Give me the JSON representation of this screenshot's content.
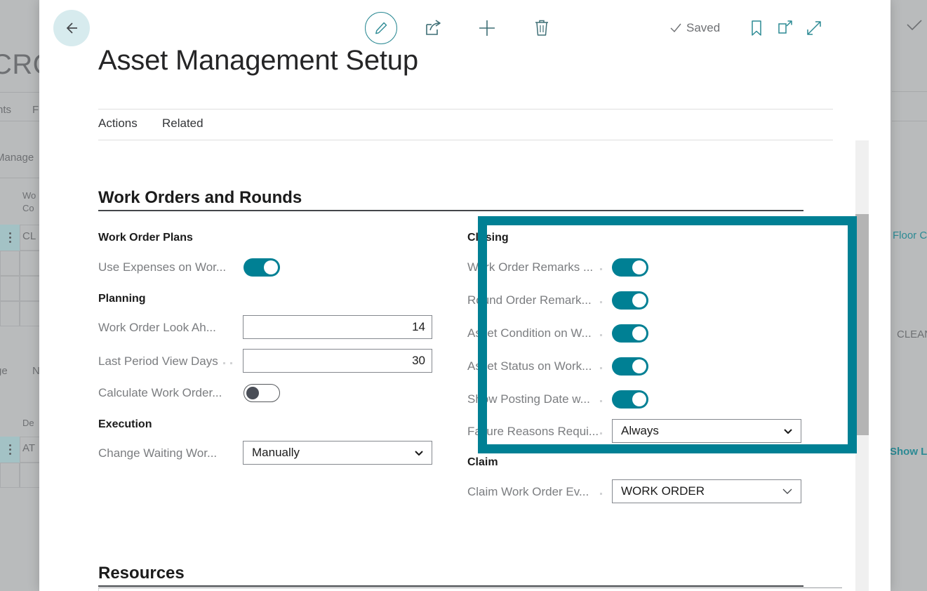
{
  "background": {
    "title": "CRO",
    "tab_a": "nts",
    "tab_b": "F",
    "menu": "Manage",
    "col_header_line1": "Wo",
    "col_header_line2": "Co",
    "row1_value": "CL",
    "lower_menu_a": "ge",
    "lower_menu_b": "N",
    "lower_col_header": "De",
    "row2_value": "AT",
    "right_link_top": "Floor C",
    "right_text": "CLEAN",
    "right_link_bottom": "Show L",
    "accent": "#2c8a94"
  },
  "toolbar": {
    "back_label": "Back",
    "edit_label": "Edit",
    "share_label": "Share",
    "new_label": "New",
    "delete_label": "Delete",
    "saved_label": "Saved",
    "bookmark_label": "Bookmark",
    "popout_label": "Open in new window",
    "expand_label": "Expand"
  },
  "page": {
    "title": "Asset Management Setup"
  },
  "tabs": [
    {
      "label": "Actions"
    },
    {
      "label": "Related"
    }
  ],
  "sections": {
    "work_orders": {
      "heading": "Work Orders and Rounds",
      "left": {
        "groups": [
          {
            "name": "Work Order Plans",
            "fields": [
              {
                "label": "Use Expenses on Wor...",
                "type": "toggle",
                "value": "on"
              }
            ]
          },
          {
            "name": "Planning",
            "fields": [
              {
                "label": "Work Order Look Ah...",
                "type": "number",
                "value": "14"
              },
              {
                "label": "Last Period View Days",
                "type": "number",
                "value": "30"
              },
              {
                "label": "Calculate Work Order...",
                "type": "toggle",
                "value": "off"
              }
            ]
          },
          {
            "name": "Execution",
            "fields": [
              {
                "label": "Change Waiting Wor...",
                "type": "select",
                "value": "Manually"
              }
            ]
          }
        ]
      },
      "right": {
        "groups": [
          {
            "name": "Closing",
            "highlighted": true,
            "fields": [
              {
                "label": "Work Order Remarks ...",
                "type": "toggle",
                "value": "on"
              },
              {
                "label": "Round Order Remark...",
                "type": "toggle",
                "value": "on"
              },
              {
                "label": "Asset Condition on W...",
                "type": "toggle",
                "value": "on"
              },
              {
                "label": "Asset Status on Work...",
                "type": "toggle",
                "value": "on"
              },
              {
                "label": "Show Posting Date w...",
                "type": "toggle",
                "value": "on"
              },
              {
                "label": "Failure Reasons Requi...",
                "type": "select",
                "value": "Always"
              }
            ]
          },
          {
            "name": "Claim",
            "fields": [
              {
                "label": "Claim Work Order Ev...",
                "type": "select",
                "value": "WORK ORDER"
              }
            ]
          }
        ]
      }
    },
    "resources": {
      "heading": "Resources"
    }
  },
  "colors": {
    "accent_teal": "#008094",
    "highlight_teal": "#008094",
    "back_circle": "#d7ebee"
  }
}
